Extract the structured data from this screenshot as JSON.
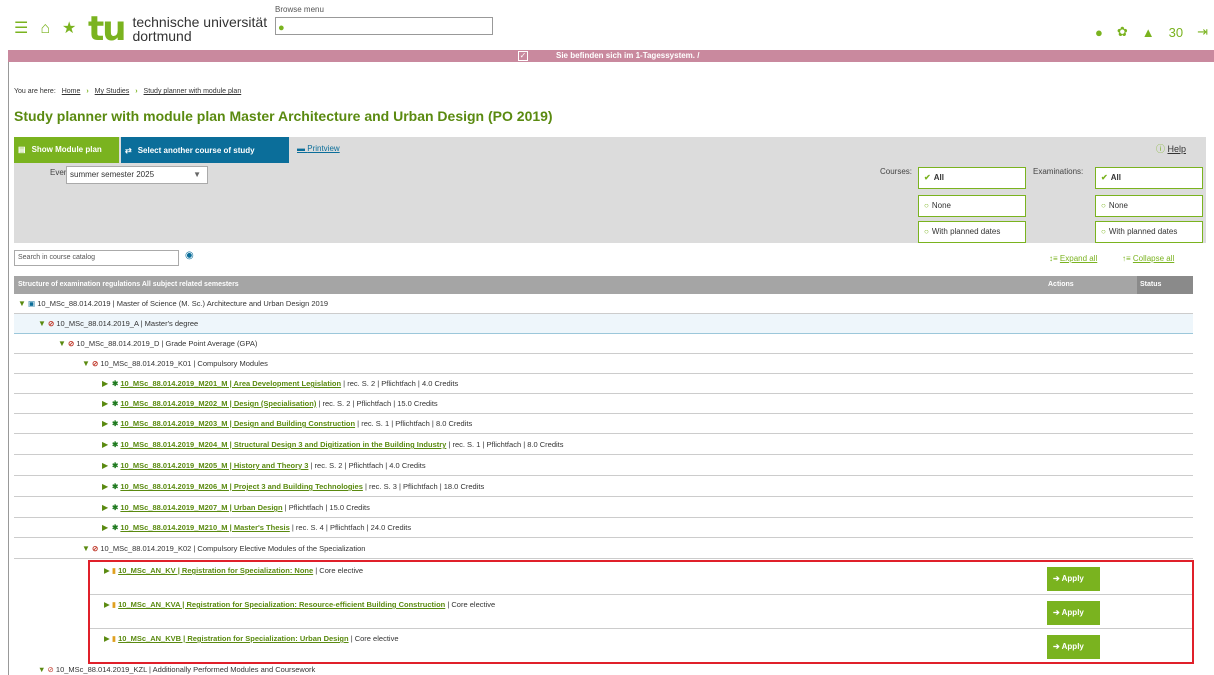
{
  "header": {
    "logo_text_1": "technische universität",
    "logo_text_2": "dortmund",
    "logo_mark": "tu",
    "browse_label": "Browse menu",
    "notification_count": "30",
    "banner_message": "Sie befinden sich im 1-Tagessystem. /"
  },
  "icons": {
    "menu": "hamburger-icon",
    "home": "home-icon",
    "star": "star-icon",
    "user": "user-icon",
    "settings": "gear-icon",
    "bell": "bell-icon",
    "logout": "logout-icon"
  },
  "breadcrumb": {
    "prefix": "You are here:",
    "items": [
      "Home",
      "My Studies",
      "Study planner with module plan"
    ]
  },
  "page_title": "Study planner with module plan Master Architecture and Urban Design (PO 2019)",
  "toolbar": {
    "show_module_plan": "Show Module plan",
    "select_course": "Select another course of study",
    "printview": "Printview",
    "help": "Help",
    "events_label": "Events",
    "events_value": "summer semester 2025",
    "courses_label": "Courses:",
    "examinations_label": "Examinations:",
    "filter_all": "All",
    "filter_none": "None",
    "filter_planned": "With planned dates"
  },
  "search": {
    "placeholder": "Search in course catalog"
  },
  "tree_controls": {
    "expand": "Expand all",
    "collapse": "Collapse all"
  },
  "table": {
    "header_structure": "Structure of examination regulations All subject related semesters",
    "header_actions": "Actions",
    "header_status": "Status"
  },
  "tree": {
    "root": "10_MSc_88.014.2019 | Master of Science (M. Sc.) Architecture and Urban Design 2019",
    "level_a": "10_MSc_88.014.2019_A | Master's degree",
    "level_d": "10_MSc_88.014.2019_D | Grade Point Average (GPA)",
    "k01": "10_MSc_88.014.2019_K01 | Compulsory Modules",
    "modules": [
      {
        "code": "10_MSc_88.014.2019_M201_M | Area Development Legislation",
        "details": "| rec. S. 2 | Pflichtfach | 4.0 Credits"
      },
      {
        "code": "10_MSc_88.014.2019_M202_M | Design (Specialisation)",
        "details": "| rec. S. 2 | Pflichtfach | 15.0 Credits"
      },
      {
        "code": "10_MSc_88.014.2019_M203_M | Design and Building Construction",
        "details": "| rec. S. 1 | Pflichtfach | 8.0 Credits"
      },
      {
        "code": "10_MSc_88.014.2019_M204_M | Structural Design 3 and Digitization in the Building Industry",
        "details": "| rec. S. 1 | Pflichtfach | 8.0 Credits"
      },
      {
        "code": "10_MSc_88.014.2019_M205_M | History and Theory 3",
        "details": "| rec. S. 2 | Pflichtfach | 4.0 Credits"
      },
      {
        "code": "10_MSc_88.014.2019_M206_M | Project 3 and Building Technologies",
        "details": "| rec. S. 3 | Pflichtfach | 18.0 Credits"
      },
      {
        "code": "10_MSc_88.014.2019_M207_M | Urban Design",
        "details": "| Pflichtfach | 15.0 Credits"
      },
      {
        "code": "10_MSc_88.014.2019_M210_M | Master's Thesis",
        "details": "| rec. S. 4 | Pflichtfach | 24.0 Credits"
      }
    ],
    "k02": "10_MSc_88.014.2019_K02 | Compulsory Elective Modules of the Specialization",
    "specializations": [
      {
        "code": "10_MSc_AN_KV | Registration for Specialization: None",
        "details": "| Core elective",
        "action": "Apply"
      },
      {
        "code": "10_MSc_AN_KVA | Registration for Specialization: Resource-efficient Building Construction",
        "details": "| Core elective",
        "action": "Apply"
      },
      {
        "code": "10_MSc_AN_KVB | Registration for Specialization: Urban Design",
        "details": "| Core elective",
        "action": "Apply"
      }
    ],
    "kzl": "10_MSc_88.014.2019_KZL | Additionally Performed Modules and Coursework"
  }
}
